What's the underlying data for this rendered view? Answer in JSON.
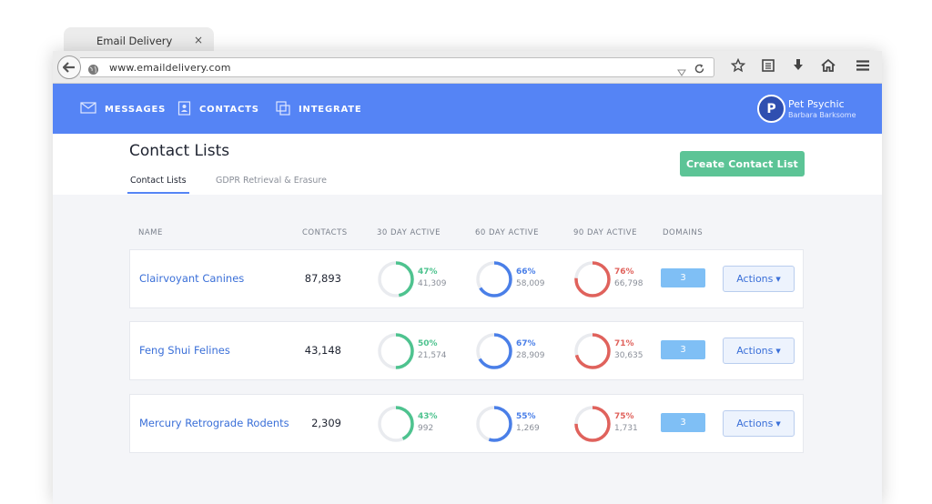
{
  "browser": {
    "tab_title": "Email Delivery",
    "tab_close": "×",
    "url": "www.emaildelivery.com"
  },
  "nav": {
    "items": [
      {
        "label": "MESSAGES",
        "icon": "envelope-icon"
      },
      {
        "label": "CONTACTS",
        "icon": "contact-book-icon"
      },
      {
        "label": "INTEGRATE",
        "icon": "integrate-icon"
      }
    ],
    "profile": {
      "initial": "P",
      "name": "Pet Psychic",
      "user": "Barbara Barksome"
    }
  },
  "page": {
    "title": "Contact Lists",
    "tabs": [
      {
        "label": "Contact Lists",
        "active": true
      },
      {
        "label": "GDPR Retrieval & Erasure",
        "active": false
      }
    ],
    "create_button": "Create Contact List"
  },
  "table": {
    "headers": [
      "NAME",
      "CONTACTS",
      "30 DAY ACTIVE",
      "60 DAY ACTIVE",
      "90 DAY ACTIVE",
      "DOMAINS"
    ],
    "rows": [
      {
        "name": "Clairvoyant Canines",
        "contacts": "87,893",
        "d30": {
          "pct": "47%",
          "count": "41,309",
          "value": 47
        },
        "d60": {
          "pct": "66%",
          "count": "58,009",
          "value": 66
        },
        "d90": {
          "pct": "76%",
          "count": "66,798",
          "value": 76
        },
        "domains": "3",
        "actions": "Actions"
      },
      {
        "name": "Feng Shui Felines",
        "contacts": "43,148",
        "d30": {
          "pct": "50%",
          "count": "21,574",
          "value": 50
        },
        "d60": {
          "pct": "67%",
          "count": "28,909",
          "value": 67
        },
        "d90": {
          "pct": "71%",
          "count": "30,635",
          "value": 71
        },
        "domains": "3",
        "actions": "Actions"
      },
      {
        "name": "Mercury Retrograde Rodents",
        "contacts": "2,309",
        "d30": {
          "pct": "43%",
          "count": "992",
          "value": 43
        },
        "d60": {
          "pct": "55%",
          "count": "1,269",
          "value": 55
        },
        "d90": {
          "pct": "75%",
          "count": "1,731",
          "value": 75
        },
        "domains": "3",
        "actions": "Actions"
      }
    ]
  },
  "colors": {
    "brand": "#5584f5",
    "d30": "#4ec38f",
    "d60": "#4a7fe8",
    "d90": "#e0625c",
    "ring_track": "#e9ebef",
    "create": "#5cc496",
    "badge": "#7fbff5"
  }
}
